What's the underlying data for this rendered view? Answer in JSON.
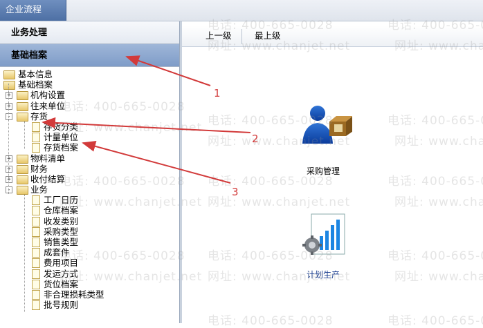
{
  "window": {
    "tab_title": "企业流程"
  },
  "sidebar": {
    "section_business": "业务处理",
    "section_archive": "基础档案"
  },
  "tree": [
    {
      "label": "基本信息",
      "level": 0,
      "kind": "folder",
      "toggle": ""
    },
    {
      "label": "基础档案",
      "level": 0,
      "kind": "folder",
      "toggle": ""
    },
    {
      "label": "机构设置",
      "level": 1,
      "kind": "folder",
      "toggle": "+"
    },
    {
      "label": "往来单位",
      "level": 1,
      "kind": "folder",
      "toggle": "+"
    },
    {
      "label": "存货",
      "level": 1,
      "kind": "folder",
      "toggle": "-"
    },
    {
      "label": "存货分类",
      "level": 2,
      "kind": "page",
      "toggle": ""
    },
    {
      "label": "计量单位",
      "level": 2,
      "kind": "page",
      "toggle": ""
    },
    {
      "label": "存货档案",
      "level": 2,
      "kind": "page",
      "toggle": ""
    },
    {
      "label": "物料清单",
      "level": 1,
      "kind": "folder",
      "toggle": "+"
    },
    {
      "label": "财务",
      "level": 1,
      "kind": "folder",
      "toggle": "+"
    },
    {
      "label": "收付结算",
      "level": 1,
      "kind": "folder",
      "toggle": "+"
    },
    {
      "label": "业务",
      "level": 1,
      "kind": "folder",
      "toggle": "-"
    },
    {
      "label": "工厂日历",
      "level": 2,
      "kind": "page",
      "toggle": ""
    },
    {
      "label": "仓库档案",
      "level": 2,
      "kind": "page",
      "toggle": ""
    },
    {
      "label": "收发类别",
      "level": 2,
      "kind": "page",
      "toggle": ""
    },
    {
      "label": "采购类型",
      "level": 2,
      "kind": "page",
      "toggle": ""
    },
    {
      "label": "销售类型",
      "level": 2,
      "kind": "page",
      "toggle": ""
    },
    {
      "label": "成套件",
      "level": 2,
      "kind": "page",
      "toggle": ""
    },
    {
      "label": "费用项目",
      "level": 2,
      "kind": "page",
      "toggle": ""
    },
    {
      "label": "发运方式",
      "level": 2,
      "kind": "page",
      "toggle": ""
    },
    {
      "label": "货位档案",
      "level": 2,
      "kind": "page",
      "toggle": ""
    },
    {
      "label": "非合理损耗类型",
      "level": 2,
      "kind": "page",
      "toggle": ""
    },
    {
      "label": "批号规则",
      "level": 2,
      "kind": "page",
      "toggle": ""
    }
  ],
  "toolbar": {
    "up_label": "上一级",
    "top_label": "最上级"
  },
  "apps": {
    "purchase": {
      "label": "采购管理",
      "icon": "purchase-manager-icon"
    },
    "planning": {
      "label": "计划生产",
      "icon": "production-plan-icon"
    }
  },
  "watermark": {
    "phone": "电话: 400-665-0028",
    "site": "网址: www.chanjet.net"
  },
  "annotations": {
    "one": "1",
    "two": "2",
    "three": "3"
  },
  "colors": {
    "annotation": "#d23a3a",
    "header_blue": "#5577aa"
  }
}
